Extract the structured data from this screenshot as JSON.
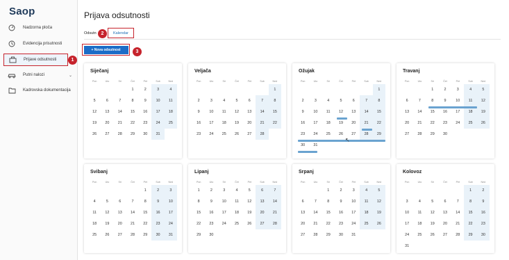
{
  "app": {
    "logo": "Saop"
  },
  "sidebar": {
    "items": [
      {
        "label": "Nadzorna ploča",
        "icon": "gauge-icon"
      },
      {
        "label": "Evidencija prisutnosti",
        "icon": "clock-icon"
      },
      {
        "label": "Prijave odsutnosti",
        "icon": "briefcase-icon",
        "active": true
      },
      {
        "label": "Putni nalozi",
        "icon": "car-icon",
        "has_submenu": true
      },
      {
        "label": "Kadrovska dokumentacija",
        "icon": "folder-icon"
      }
    ]
  },
  "page": {
    "title": "Prijava odsutnosti"
  },
  "tabs": {
    "odsutnosti": "Odsutn",
    "kalendar": "Kalendar"
  },
  "toolbar": {
    "new_absence": "+ Nova odsutnost"
  },
  "badges": [
    "1",
    "2",
    "3"
  ],
  "weekdays": [
    "Pon",
    "Uto",
    "Sri",
    "Čet",
    "Pet",
    "Sub",
    "Ned"
  ],
  "months": [
    {
      "name": "Siječanj",
      "offset": 3,
      "days": 31
    },
    {
      "name": "Veljača",
      "offset": 6,
      "days": 28
    },
    {
      "name": "Ožujak",
      "offset": 6,
      "days": 31
    },
    {
      "name": "Travanj",
      "offset": 2,
      "days": 30
    },
    {
      "name": "Svibanj",
      "offset": 4,
      "days": 31
    },
    {
      "name": "Lipanj",
      "offset": 0,
      "days": 30
    },
    {
      "name": "Srpanj",
      "offset": 2,
      "days": 31
    },
    {
      "name": "Kolovoz",
      "offset": 5,
      "days": 31
    }
  ],
  "colors": {
    "accent": "#1b6cc7",
    "highlight": "#c6232c",
    "absence": "#6aa3d0",
    "weekend": "#e9f2f9"
  }
}
